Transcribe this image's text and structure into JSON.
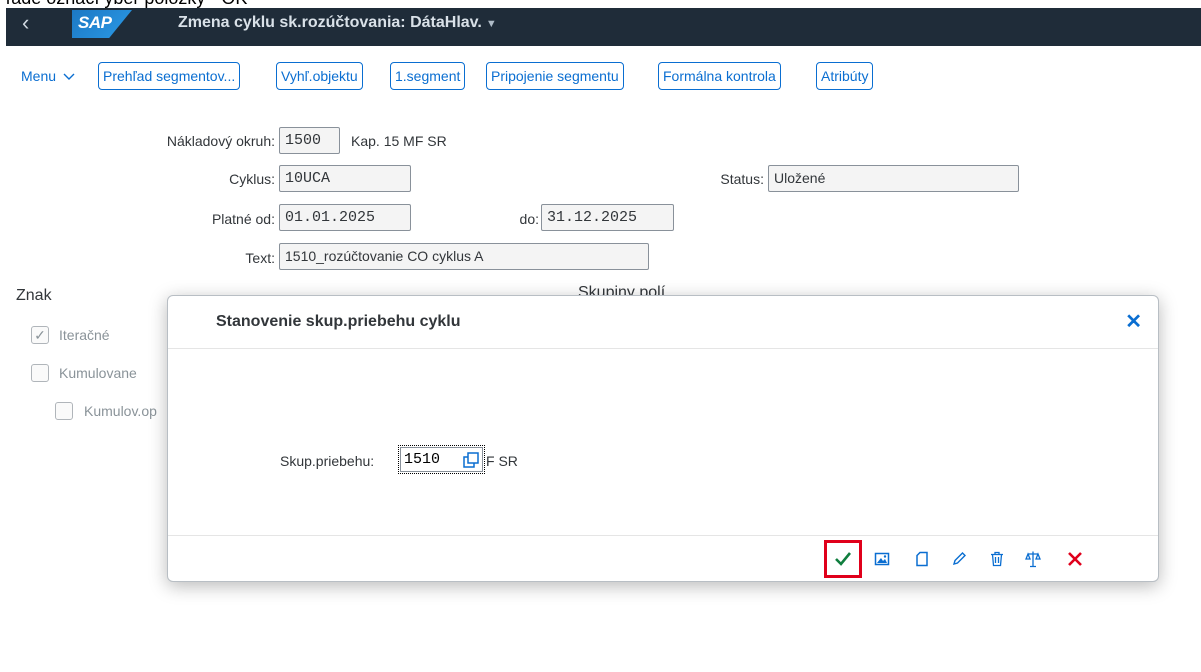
{
  "caption": {
    "text": "ľade označí ýber položky - OK"
  },
  "shell": {
    "title": "Zmena cyklu sk.rozúčtovania: DátaHlav.",
    "logo_text": "SAP"
  },
  "toolbar": {
    "menu_label": "Menu",
    "buttons": [
      "Prehľad segmentov...",
      "Vyhľ.objektu",
      "1.segment",
      "Pripojenie segmentu",
      "Formálna kontrola",
      "Atribúty"
    ]
  },
  "form": {
    "nakladovy_okruh": {
      "label": "Nákladový okruh:",
      "value": "1500",
      "desc": "Kap. 15 MF SR"
    },
    "cyklus": {
      "label": "Cyklus:",
      "value": "10UCA"
    },
    "status": {
      "label": "Status:",
      "value": "Uložené"
    },
    "platne_od": {
      "label": "Platné od:",
      "value": "01.01.2025"
    },
    "do": {
      "label": "do:",
      "value": "31.12.2025"
    },
    "text": {
      "label": "Text:",
      "value": "1510_rozúčtovanie CO cyklus A"
    }
  },
  "sections": {
    "znak": "Znak",
    "skupiny_poli": "Skupiny polí"
  },
  "znak_options": {
    "iteracne": {
      "label": "Iteračné",
      "checked": true
    },
    "kumulovane": {
      "label": "Kumulovane",
      "checked": false
    },
    "kumulov_op": {
      "label": "Kumulov.op",
      "checked": false
    }
  },
  "dialog": {
    "title": "Stanovenie skup.priebehu cyklu",
    "field_label": "Skup.priebehu:",
    "field_value": "1510",
    "field_suffix": "F SR",
    "actions": [
      "confirm-icon",
      "image-icon",
      "new-document-icon",
      "edit-pencil-icon",
      "trash-icon",
      "compare-icon",
      "cancel-icon"
    ]
  },
  "colors": {
    "shell_bg": "#1f2c39",
    "accent": "#0a6ed1",
    "confirm_green": "#107e3e",
    "cancel_red": "#e0001b",
    "highlight_red": "#e0001b"
  }
}
